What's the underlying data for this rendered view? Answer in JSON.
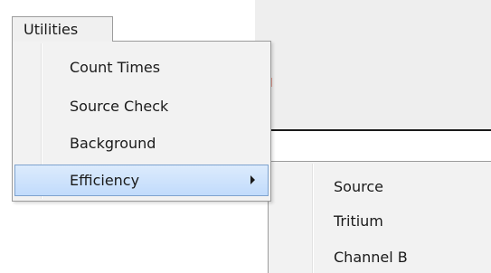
{
  "menubar": {
    "active_item": "Utilities"
  },
  "utilities_menu": {
    "items": [
      {
        "label": "Count Times",
        "has_submenu": false,
        "highlighted": false
      },
      {
        "label": "Source Check",
        "has_submenu": false,
        "highlighted": false
      },
      {
        "label": "Background",
        "has_submenu": false,
        "highlighted": false
      },
      {
        "label": "Efficiency",
        "has_submenu": true,
        "highlighted": true
      }
    ]
  },
  "efficiency_submenu": {
    "items": [
      {
        "label": "Source"
      },
      {
        "label": "Tritium"
      },
      {
        "label": "Channel B"
      }
    ]
  },
  "colors": {
    "highlight_fill": "#c1dbfc",
    "highlight_border": "#7da2ce",
    "menu_background": "#f2f2f2",
    "menu_border": "#9c9c9c"
  }
}
